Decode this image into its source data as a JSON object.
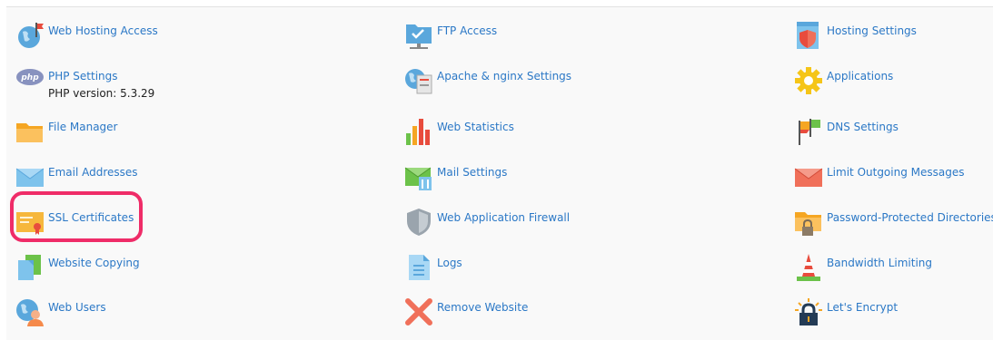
{
  "colors": {
    "link": "#2b78c6",
    "highlight": "#ef2c68",
    "text": "#222222"
  },
  "columns": [
    {
      "items": [
        {
          "label": "Web Hosting Access",
          "icon": "globe-flag-icon"
        },
        {
          "label": "PHP Settings",
          "icon": "php-icon",
          "sub": "PHP version: 5.3.29"
        },
        {
          "label": "File Manager",
          "icon": "folder-icon"
        },
        {
          "label": "Email Addresses",
          "icon": "envelope-icon"
        },
        {
          "label": "SSL Certificates",
          "icon": "certificate-icon"
        },
        {
          "label": "Website Copying",
          "icon": "copy-pages-icon"
        },
        {
          "label": "Web Users",
          "icon": "user-globe-icon"
        }
      ]
    },
    {
      "items": [
        {
          "label": "FTP Access",
          "icon": "ftp-folder-icon"
        },
        {
          "label": "Apache & nginx Settings",
          "icon": "server-globe-icon"
        },
        {
          "label": "Web Statistics",
          "icon": "bar-chart-icon"
        },
        {
          "label": "Mail Settings",
          "icon": "mail-settings-icon"
        },
        {
          "label": "Web Application Firewall",
          "icon": "shield-icon"
        },
        {
          "label": "Logs",
          "icon": "document-log-icon"
        },
        {
          "label": "Remove Website",
          "icon": "remove-x-icon"
        }
      ]
    },
    {
      "items": [
        {
          "label": "Hosting Settings",
          "icon": "hosting-settings-icon"
        },
        {
          "label": "Applications",
          "icon": "gear-icon"
        },
        {
          "label": "DNS Settings",
          "icon": "dns-flags-icon"
        },
        {
          "label": "Limit Outgoing Messages",
          "icon": "envelope-red-icon"
        },
        {
          "label": "Password-Protected Directories",
          "icon": "lock-folder-icon"
        },
        {
          "label": "Bandwidth Limiting",
          "icon": "cone-icon"
        },
        {
          "label": "Let's Encrypt",
          "icon": "encrypt-lock-icon"
        }
      ]
    }
  ]
}
